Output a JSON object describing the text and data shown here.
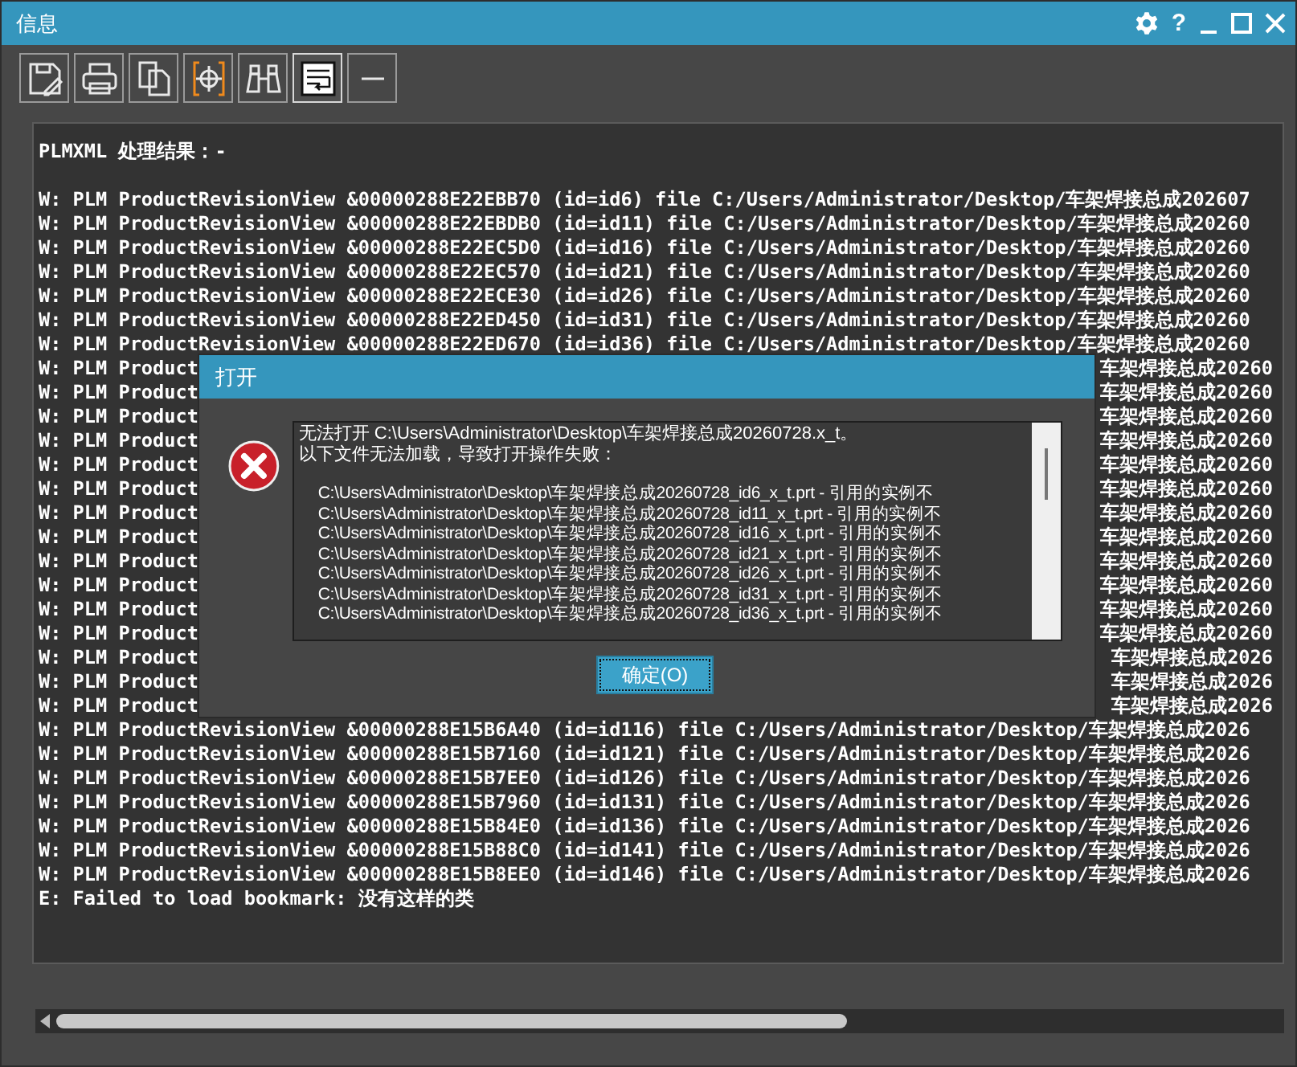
{
  "window": {
    "title": "信息",
    "help_label": "?"
  },
  "toolbar": [
    {
      "kind": "save",
      "on": false
    },
    {
      "kind": "print",
      "on": false
    },
    {
      "kind": "copy",
      "on": false
    },
    {
      "kind": "target",
      "on": false
    },
    {
      "kind": "find",
      "on": false
    },
    {
      "kind": "wrap",
      "on": true
    },
    {
      "kind": "minus",
      "on": false
    }
  ],
  "log": {
    "header": "PLMXML 处理结果：-",
    "lines": [
      {
        "kind": "full",
        "text": "W: PLM ProductRevisionView &00000288E22EBB70 (id=id6) file C:/Users/Administrator/Desktop/车架焊接总成202607"
      },
      {
        "kind": "full",
        "text": "W: PLM ProductRevisionView &00000288E22EBDB0 (id=id11) file C:/Users/Administrator/Desktop/车架焊接总成20260"
      },
      {
        "kind": "full",
        "text": "W: PLM ProductRevisionView &00000288E22EC5D0 (id=id16) file C:/Users/Administrator/Desktop/车架焊接总成20260"
      },
      {
        "kind": "full",
        "text": "W: PLM ProductRevisionView &00000288E22EC570 (id=id21) file C:/Users/Administrator/Desktop/车架焊接总成20260"
      },
      {
        "kind": "full",
        "text": "W: PLM ProductRevisionView &00000288E22ECE30 (id=id26) file C:/Users/Administrator/Desktop/车架焊接总成20260"
      },
      {
        "kind": "full",
        "text": "W: PLM ProductRevisionView &00000288E22ED450 (id=id31) file C:/Users/Administrator/Desktop/车架焊接总成20260"
      },
      {
        "kind": "full",
        "text": "W: PLM ProductRevisionView &00000288E22ED670 (id=id36) file C:/Users/Administrator/Desktop/车架焊接总成20260"
      },
      {
        "kind": "covered",
        "left": "W: PLM Product",
        "right": "车架焊接总成20260"
      },
      {
        "kind": "covered",
        "left": "W: PLM Product",
        "right": "车架焊接总成20260"
      },
      {
        "kind": "covered",
        "left": "W: PLM Product",
        "right": "车架焊接总成20260"
      },
      {
        "kind": "covered",
        "left": "W: PLM Product",
        "right": "车架焊接总成20260"
      },
      {
        "kind": "covered",
        "left": "W: PLM Product",
        "right": "车架焊接总成20260"
      },
      {
        "kind": "covered",
        "left": "W: PLM Product",
        "right": "车架焊接总成20260"
      },
      {
        "kind": "covered",
        "left": "W: PLM Product",
        "right": "车架焊接总成20260"
      },
      {
        "kind": "covered",
        "left": "W: PLM Product",
        "right": "车架焊接总成20260"
      },
      {
        "kind": "covered",
        "left": "W: PLM Product",
        "right": "车架焊接总成20260"
      },
      {
        "kind": "covered",
        "left": "W: PLM Product",
        "right": "车架焊接总成20260"
      },
      {
        "kind": "covered",
        "left": "W: PLM Product",
        "right": "车架焊接总成20260"
      },
      {
        "kind": "covered",
        "left": "W: PLM Product",
        "right": "车架焊接总成20260"
      },
      {
        "kind": "covered",
        "left": "W: PLM Product",
        "right": "车架焊接总成2026"
      },
      {
        "kind": "covered",
        "left": "W: PLM Product",
        "right": "车架焊接总成2026"
      },
      {
        "kind": "covered",
        "left": "W: PLM Product",
        "right": "车架焊接总成2026"
      },
      {
        "kind": "full",
        "text": "W: PLM ProductRevisionView &00000288E15B6A40 (id=id116) file C:/Users/Administrator/Desktop/车架焊接总成2026"
      },
      {
        "kind": "full",
        "text": "W: PLM ProductRevisionView &00000288E15B7160 (id=id121) file C:/Users/Administrator/Desktop/车架焊接总成2026"
      },
      {
        "kind": "full",
        "text": "W: PLM ProductRevisionView &00000288E15B7EE0 (id=id126) file C:/Users/Administrator/Desktop/车架焊接总成2026"
      },
      {
        "kind": "full",
        "text": "W: PLM ProductRevisionView &00000288E15B7960 (id=id131) file C:/Users/Administrator/Desktop/车架焊接总成2026"
      },
      {
        "kind": "full",
        "text": "W: PLM ProductRevisionView &00000288E15B84E0 (id=id136) file C:/Users/Administrator/Desktop/车架焊接总成2026"
      },
      {
        "kind": "full",
        "text": "W: PLM ProductRevisionView &00000288E15B88C0 (id=id141) file C:/Users/Administrator/Desktop/车架焊接总成2026"
      },
      {
        "kind": "full",
        "text": "W: PLM ProductRevisionView &00000288E15B8EE0 (id=id146) file C:/Users/Administrator/Desktop/车架焊接总成2026"
      },
      {
        "kind": "full",
        "text": "E: Failed to load bookmark: 没有这样的类"
      }
    ]
  },
  "dialog": {
    "title": "打开",
    "message": [
      "无法打开 C:\\Users\\Administrator\\Desktop\\车架焊接总成20260728.x_t。",
      "以下文件无法加载，导致打开操作失败："
    ],
    "files": [
      {
        "path": "C:\\Users\\Administrator\\Desktop\\车架焊接总成20260728_id6_x_t.prt",
        "note": "- 引用的实例不"
      },
      {
        "path": "C:\\Users\\Administrator\\Desktop\\车架焊接总成20260728_id11_x_t.prt",
        "note": "- 引用的实例不"
      },
      {
        "path": "C:\\Users\\Administrator\\Desktop\\车架焊接总成20260728_id16_x_t.prt",
        "note": "- 引用的实例不"
      },
      {
        "path": "C:\\Users\\Administrator\\Desktop\\车架焊接总成20260728_id21_x_t.prt",
        "note": "- 引用的实例不"
      },
      {
        "path": "C:\\Users\\Administrator\\Desktop\\车架焊接总成20260728_id26_x_t.prt",
        "note": "- 引用的实例不"
      },
      {
        "path": "C:\\Users\\Administrator\\Desktop\\车架焊接总成20260728_id31_x_t.prt",
        "note": "- 引用的实例不"
      },
      {
        "path": "C:\\Users\\Administrator\\Desktop\\车架焊接总成20260728_id36_x_t.prt",
        "note": "- 引用的实例不"
      }
    ],
    "ok_button": "确定(O)"
  }
}
